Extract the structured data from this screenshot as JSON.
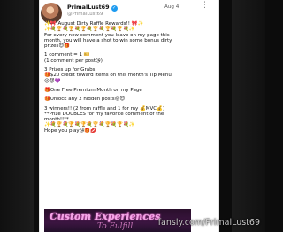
{
  "post": {
    "author_name": "PrimalLust69",
    "verified_icon": "verified-badge-icon",
    "handle": "@PrimalLust69",
    "date": "Aug 4",
    "menu_icon": "more-vertical-icon",
    "lines": [
      "✨🎀 August Dirty Raffle Rewards!! 🎀✨",
      "✨💐🏆💐🏆💐🏆💐🏆💐🏆💐🏆💐✨",
      "For every new comment you leave on my page this",
      "month, you will have a shot to win some bonus dirty",
      "prizes😈🎁",
      "",
      "1 comment = 1 🎫",
      "(1 comment per post😘)",
      "",
      "3 Prizes up for Grabs:",
      "🎁$20 credit toward items on this month's Tip Menu",
      "😜😈💜",
      "",
      "🎁One Free Premium Month on my Page",
      "",
      "🎁Unlock any 2 hidden posts😜😈",
      "",
      "3 winners!! (2 from raffle and 1 for my 💰MVC💰)",
      "**Prize DOUBLES for my favorite comment of the",
      "month!!**",
      "✨💐🏆💐🏆💐🏆💐🏆💐🏆💐🏆💐✨",
      "Hope you play😘🎁💋"
    ]
  },
  "promo": {
    "headline": "Custom Experiences",
    "sub": "To Fulfill"
  },
  "watermark": "fansly.com/PrimalLust69",
  "colors": {
    "background": "#0c0c0c",
    "card": "#ffffff",
    "verified": "#1d9bf0",
    "promo_text": "#f3a6e6"
  }
}
